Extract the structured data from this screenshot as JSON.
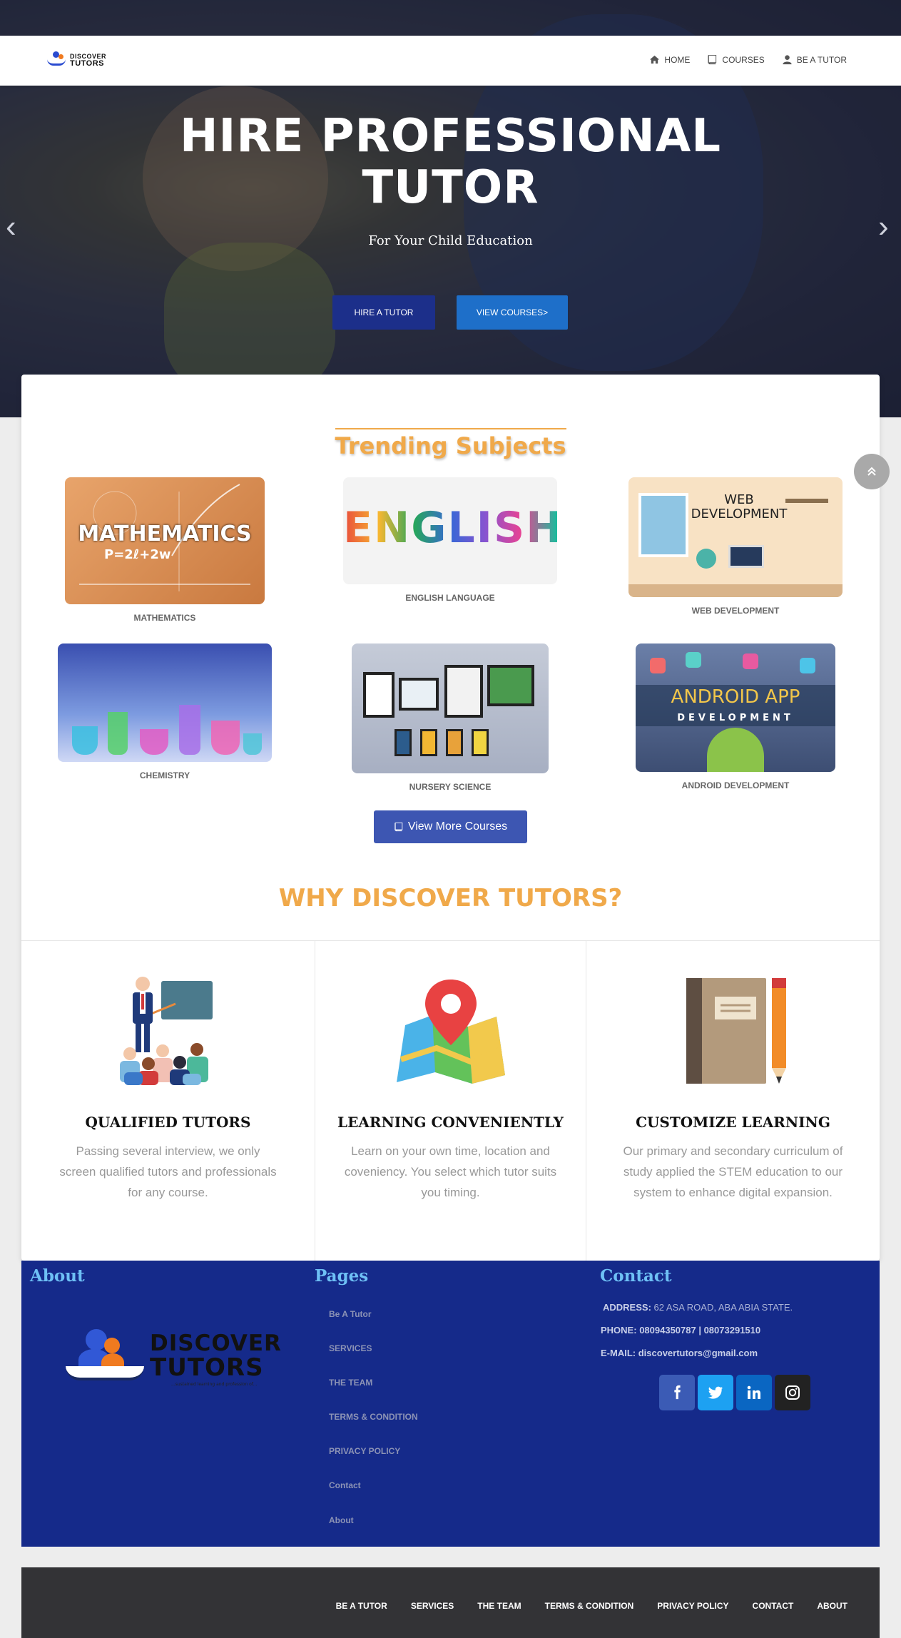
{
  "logo": {
    "line1": "DISCOVER",
    "line2": "TUTORS",
    "tagline": "...sustained learning and profession of..."
  },
  "nav": [
    {
      "label": "HOME",
      "icon": "home-icon"
    },
    {
      "label": "COURSES",
      "icon": "book-icon"
    },
    {
      "label": "BE A TUTOR",
      "icon": "user-icon"
    }
  ],
  "hero": {
    "title_line1": "HIRE PROFESSIONAL",
    "title_line2": "TUTOR",
    "subtitle": "For Your Child Education",
    "hire_button": "HIRE A TUTOR",
    "view_button": "VIEW COURSES>",
    "prev_arrow": "‹",
    "next_arrow": "›"
  },
  "trending": {
    "title": "Trending Subjects",
    "subjects": [
      {
        "label": "MATHEMATICS",
        "image_text": "MATHEMATICS",
        "image_sub": "P=2ℓ+2w"
      },
      {
        "label": "ENGLISH LANGUAGE",
        "image_text": "ENGLISH"
      },
      {
        "label": "WEB DEVELOPMENT",
        "image_text": "WEB DEVELOPMENT"
      },
      {
        "label": "CHEMISTRY"
      },
      {
        "label": "NURSERY SCIENCE"
      },
      {
        "label": "ANDROID DEVELOPMENT",
        "image_text": "ANDROID APP",
        "image_sub": "DEVELOPMENT"
      }
    ],
    "more_button": "View More Courses"
  },
  "why": {
    "title": "WHY DISCOVER TUTORS?",
    "features": [
      {
        "title": "QUALIFIED TUTORS",
        "text": "Passing several interview, we only screen qualified tutors and professionals for any course."
      },
      {
        "title": "LEARNING CONVENIENTLY",
        "text": "Learn on your own time, location and coveniency. You select which tutor suits you timing."
      },
      {
        "title": "CUSTOMIZE LEARNING",
        "text": "Our primary and secondary curriculum of study applied the STEM education to our system to enhance digital expansion."
      }
    ]
  },
  "footer": {
    "about_heading": "About",
    "pages_heading": "Pages",
    "contact_heading": "Contact",
    "logo_line1": "DISCOVER",
    "logo_line2": "TUTORS",
    "logo_tagline": "...sustained learning and profession of...",
    "pages": [
      "Be A Tutor",
      "SERVICES",
      "THE TEAM",
      "TERMS & CONDITION",
      "PRIVACY POLICY",
      "Contact",
      "About"
    ],
    "address_label": "ADDRESS:",
    "address": "62 ASA ROAD, ABA ABIA STATE.",
    "phone_label": "PHONE:",
    "phone": "08094350787 | 08073291510",
    "email_label": "E-MAIL:",
    "email": "discovertutors@gmail.com",
    "social": [
      {
        "icon": "facebook-icon",
        "glyph": "f",
        "color": "#3b5bb5"
      },
      {
        "icon": "twitter-icon",
        "glyph": "t",
        "color": "#1da1f2"
      },
      {
        "icon": "linkedin-icon",
        "glyph": "in",
        "color": "#0a66c2"
      },
      {
        "icon": "instagram-icon",
        "glyph": "ig",
        "color": "#222222"
      }
    ]
  },
  "bottom_links": [
    "BE A TUTOR",
    "SERVICES",
    "THE TEAM",
    "TERMS & CONDITION",
    "PRIVACY POLICY",
    "CONTACT",
    "ABOUT"
  ],
  "colors": {
    "accent": "#f0a94a",
    "footer_bg": "#152a8a",
    "hire_btn": "#1c2f8a",
    "view_btn": "#1e6fc9"
  }
}
